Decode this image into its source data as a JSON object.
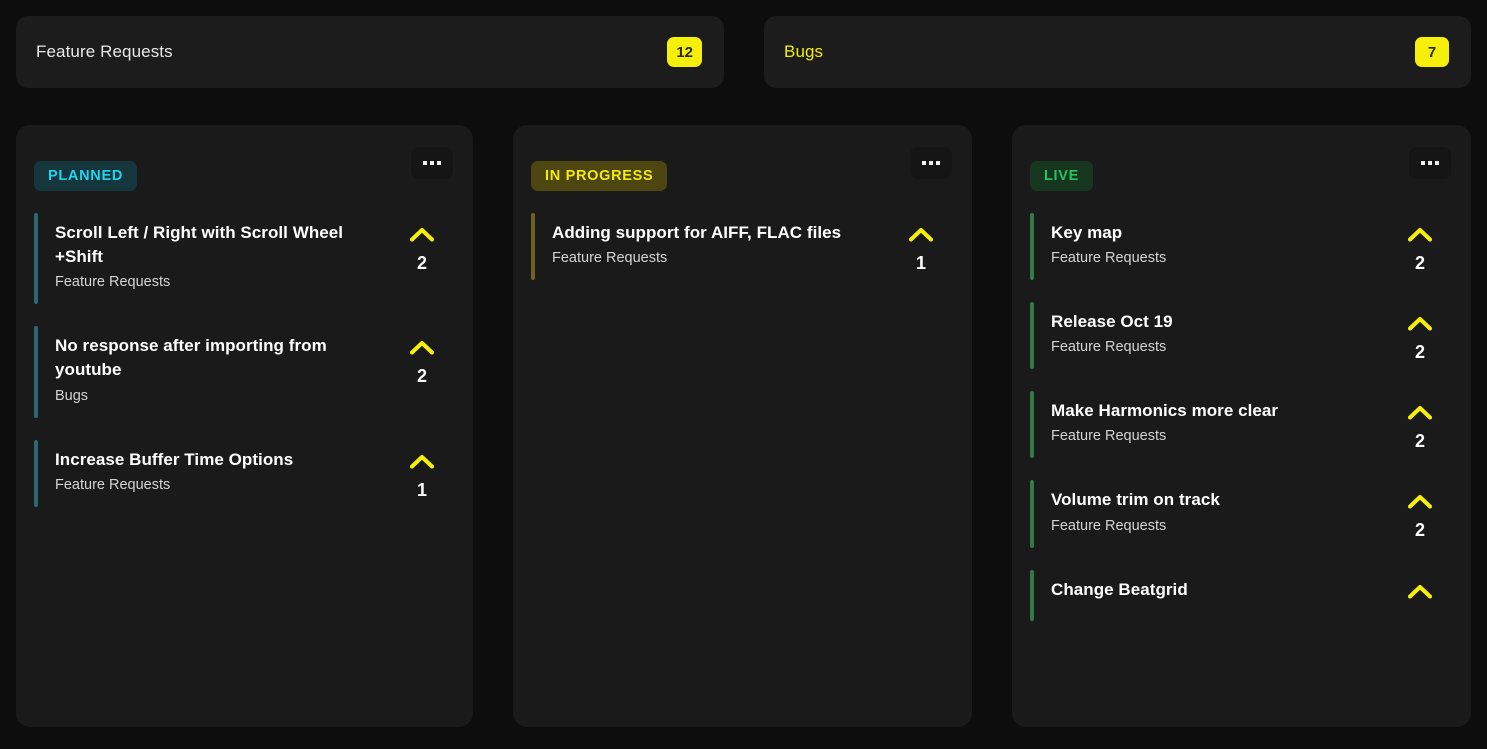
{
  "header": {
    "cards": [
      {
        "title": "Feature Requests",
        "count": "12",
        "active": false
      },
      {
        "title": "Bugs",
        "count": "7",
        "active": true
      }
    ]
  },
  "board": {
    "more_menu_icon": "ellipsis-icon",
    "upvote_icon": "chevron-up-icon",
    "columns": [
      {
        "status": "PLANNED",
        "theme": "planned",
        "cards": [
          {
            "title": "Scroll Left / Right with Scroll Wheel +Shift",
            "category": "Feature Requests",
            "votes": "2"
          },
          {
            "title": "No response after importing from youtube",
            "category": "Bugs",
            "votes": "2"
          },
          {
            "title": "Increase Buffer Time Options",
            "category": "Feature Requests",
            "votes": "1"
          }
        ]
      },
      {
        "status": "IN PROGRESS",
        "theme": "progress",
        "cards": [
          {
            "title": "Adding support for AIFF, FLAC files",
            "category": "Feature Requests",
            "votes": "1"
          }
        ]
      },
      {
        "status": "LIVE",
        "theme": "live",
        "cards": [
          {
            "title": "Key map",
            "category": "Feature Requests",
            "votes": "2"
          },
          {
            "title": "Release Oct 19",
            "category": "Feature Requests",
            "votes": "2"
          },
          {
            "title": "Make Harmonics more clear",
            "category": "Feature Requests",
            "votes": "2"
          },
          {
            "title": "Volume trim on track",
            "category": "Feature Requests",
            "votes": "2"
          },
          {
            "title": "Change Beatgrid",
            "category": "",
            "votes": ""
          }
        ]
      }
    ]
  },
  "colors": {
    "page_bg": "#0d0d0d",
    "column_bg": "#1a1a1a",
    "accent_yellow": "#f5ef0a",
    "planned_cyan": "#22d3ee",
    "progress_yellow": "#f2ec0d",
    "live_green": "#22c55e"
  }
}
